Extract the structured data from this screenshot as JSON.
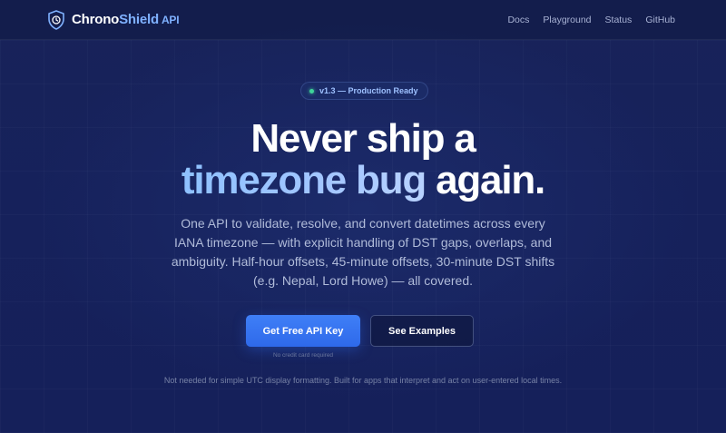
{
  "brand": {
    "name_part1": "Chrono",
    "name_part2": "Shield",
    "suffix": "API",
    "icon": "shield-clock-icon"
  },
  "nav": {
    "items": [
      {
        "label": "Docs"
      },
      {
        "label": "Playground"
      },
      {
        "label": "Status"
      },
      {
        "label": "GitHub"
      }
    ]
  },
  "hero": {
    "badge": "v1.3 — Production Ready",
    "headline_line1": "Never ship a",
    "headline_accent": "timezone bug",
    "headline_line2_end": "again.",
    "description": "One API to validate, resolve, and convert datetimes across every IANA timezone — with explicit handling of DST gaps, overlaps, and ambiguity. Half-hour offsets, 45-minute offsets, 30-minute DST shifts (e.g. Nepal, Lord Howe) — all covered.",
    "primary_cta": "Get Free API Key",
    "secondary_cta": "See Examples",
    "cta_note": "No credit card required",
    "footnote": "Not needed for simple UTC display formatting. Built for apps that interpret and act on user-entered local times."
  },
  "colors": {
    "background": "#15215a",
    "accent": "#7fb1ff",
    "primary_button": "#3a78f2",
    "status_dot": "#3fd49a"
  }
}
